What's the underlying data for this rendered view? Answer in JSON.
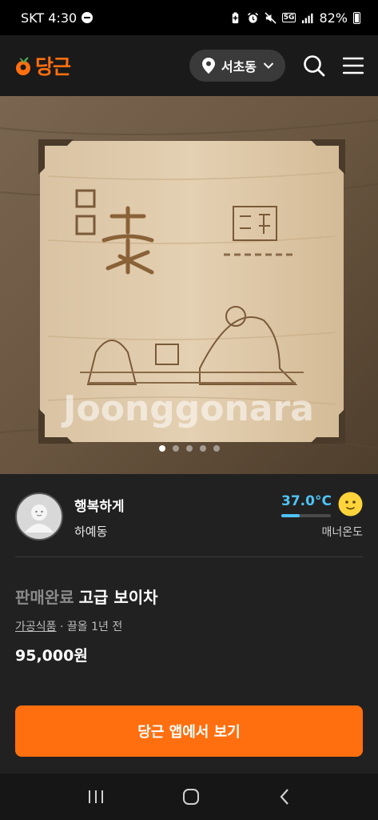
{
  "status_bar": {
    "carrier_time": "SKT 4:30",
    "network": "5G",
    "battery": "82%"
  },
  "header": {
    "logo_text": "당근",
    "location": "서초동",
    "brand_color": "#ff6f0f"
  },
  "gallery": {
    "watermark": "Joonggonara",
    "photo_count": 5,
    "active_index": 0
  },
  "seller": {
    "name": "행복하게",
    "region": "하예동",
    "manner_temperature": "37.0°C",
    "manner_label": "매너온도",
    "manner_level_percent": 37
  },
  "listing": {
    "status": "판매완료",
    "title": "고급 보이차",
    "category": "가공식품",
    "meta_separator": " · ",
    "time": "끌올 1년 전",
    "price": "95,000원"
  },
  "cta": {
    "label": "당근 앱에서 보기"
  },
  "icons": {
    "logo": "carrot-icon",
    "location": "location-pin-icon",
    "dropdown": "chevron-down-icon",
    "search": "search-icon",
    "menu": "hamburger-menu-icon",
    "nav_recents": "recent-apps-icon",
    "nav_home": "home-icon",
    "nav_back": "back-icon"
  }
}
